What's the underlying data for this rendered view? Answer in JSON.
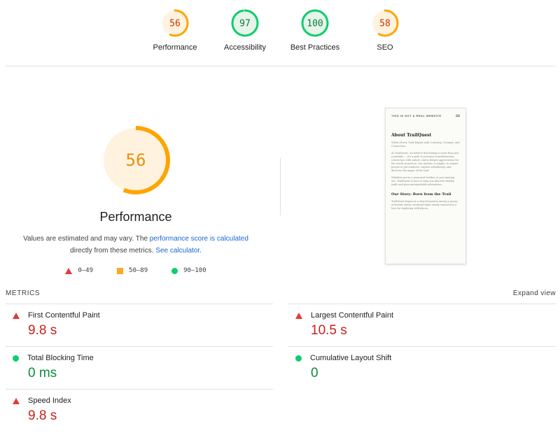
{
  "gauges": [
    {
      "score": "56",
      "label": "Performance",
      "value": 56,
      "color": "#ffa400",
      "fill": "#fff3e0"
    },
    {
      "score": "97",
      "label": "Accessibility",
      "value": 97,
      "color": "#0cce6b",
      "fill": "#e6f4ea"
    },
    {
      "score": "100",
      "label": "Best Practices",
      "value": 100,
      "color": "#0cce6b",
      "fill": "#e6f4ea"
    },
    {
      "score": "58",
      "label": "SEO",
      "value": 58,
      "color": "#ffa400",
      "fill": "#fff3e0"
    }
  ],
  "main": {
    "score": "56",
    "value": 56,
    "title": "Performance",
    "desc_prefix": "Values are estimated and may vary. The ",
    "desc_link": "performance score is calculated",
    "desc_mid": "directly from these metrics. ",
    "desc_link2": "See calculator.",
    "legend": [
      {
        "icon": "triangle",
        "range": "0–49"
      },
      {
        "icon": "square",
        "range": "50–89"
      },
      {
        "icon": "circle",
        "range": "90–100"
      }
    ]
  },
  "thumbnail": {
    "banner": "THIS IS NOT A REAL WEBSITE",
    "heading": "About TrailQuest",
    "p1": "Where Every Trail Begins with Curiosity, Courage, and Connection",
    "p2": "At TrailQuest, we believe that hiking is more than just a pastime — it's a path to personal transformation, connection with nature, and a deeper appreciation for the world around us. Our mission is simple: to inspire people to get outdoors, explore relentlessly, and discover the magic of the trail.",
    "p3": "Whether you're a seasoned trekker or just starting out, TrailQuest is here to help you discover hidden trails and plan unforgettable adventures.",
    "heading2": "Our Story: Born from the Trail",
    "p4": "TrailQuest began as a shared passion among a group of friends whose weekend hikes slowly turned into a love for exploring wild places."
  },
  "metrics": {
    "header": "METRICS",
    "expand": "Expand view",
    "left": [
      {
        "label": "First Contentful Paint",
        "value": "9.8 s",
        "status": "fail"
      },
      {
        "label": "Total Blocking Time",
        "value": "0 ms",
        "status": "pass"
      },
      {
        "label": "Speed Index",
        "value": "9.8 s",
        "status": "fail"
      }
    ],
    "right": [
      {
        "label": "Largest Contentful Paint",
        "value": "10.5 s",
        "status": "fail"
      },
      {
        "label": "Cumulative Layout Shift",
        "value": "0",
        "status": "pass"
      }
    ]
  }
}
